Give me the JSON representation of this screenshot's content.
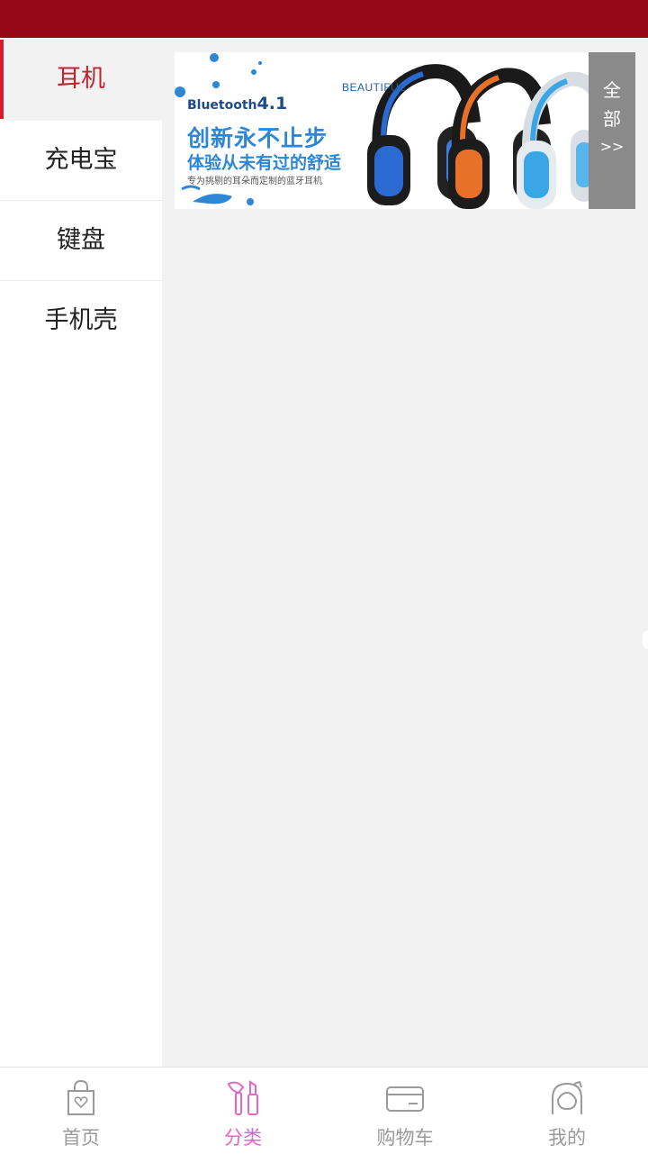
{
  "colors": {
    "status_bar": "#960717",
    "active_category": "#c0242e",
    "active_tab": "#e763c9",
    "inactive_tab": "#9a9a9a"
  },
  "sidebar": {
    "items": [
      {
        "label": "耳机",
        "active": true
      },
      {
        "label": "充电宝",
        "active": false
      },
      {
        "label": "键盘",
        "active": false
      },
      {
        "label": "手机壳",
        "active": false
      }
    ]
  },
  "banner": {
    "bluetooth_text": "Bluetooth",
    "bluetooth_version": "4.1",
    "beautiful_text": "BEAUTIFUL",
    "slogan_main": "创新永不止步",
    "slogan_sub": "体验从未有过的舒适",
    "slogan_small": "专为挑剔的耳朵而定制的蓝牙耳机"
  },
  "all_button": {
    "line1": "全",
    "line2": "部",
    "arrow": ">>"
  },
  "tabbar": {
    "tabs": [
      {
        "label": "首页",
        "icon": "shopping-bag-icon",
        "active": false
      },
      {
        "label": "分类",
        "icon": "makeup-icon",
        "active": true
      },
      {
        "label": "购物车",
        "icon": "card-icon",
        "active": false
      },
      {
        "label": "我的",
        "icon": "profile-icon",
        "active": false
      }
    ]
  }
}
